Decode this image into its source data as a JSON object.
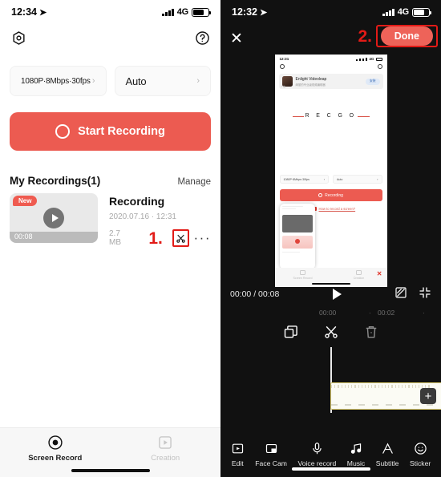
{
  "left": {
    "status": {
      "time": "12:34",
      "network": "4G"
    },
    "header": {
      "settings_icon": "gear-hex-icon",
      "help_icon": "question-circle-icon"
    },
    "selectors": [
      {
        "label": "1080P·8Mbps·30fps",
        "chevron": "›"
      },
      {
        "label": "Auto",
        "chevron": "›"
      }
    ],
    "start_button": {
      "label": "Start Recording"
    },
    "recordings": {
      "title": "My Recordings(1)",
      "manage": "Manage",
      "item": {
        "badge": "New",
        "duration": "00:08",
        "name": "Recording",
        "date": "2020.07.16 · 12:31",
        "size": "2.7 MB",
        "step_marker": "1.",
        "cut_icon": "scissors-icon",
        "more_icon": "ellipsis-icon"
      }
    },
    "tabs": [
      {
        "label": "Screen Record",
        "icon": "record-circle-icon",
        "active": true
      },
      {
        "label": "Creation",
        "icon": "play-square-icon",
        "active": false
      }
    ]
  },
  "right": {
    "status": {
      "time": "12:32",
      "network": "4G"
    },
    "editor": {
      "close_icon": "close-x-icon",
      "step_marker": "2.",
      "done_label": "Done"
    },
    "preview": {
      "inner_status_time": "12:31",
      "inner_network": "4G",
      "ad": {
        "title": "Enlight Videoleap",
        "subtitle": "绚丽的专业级视频编辑器",
        "button": "安装",
        "tag": "广告"
      },
      "watermark": "R E C G O",
      "selectors": [
        "1080P·8Mbps·30fps",
        "Auto"
      ],
      "record_button": "Recording",
      "help_link": "How to record a screen?",
      "tabs": [
        "Screen Record",
        "Creation"
      ]
    },
    "player": {
      "time_display": "00:00 / 00:08",
      "play_icon": "play-icon",
      "ratio_icon": "aspect-ratio-icon",
      "collapse_icon": "collapse-icon"
    },
    "ruler": {
      "ticks": [
        "00:00",
        "00:02"
      ]
    },
    "tools": [
      {
        "name": "duplicate-icon",
        "label": ""
      },
      {
        "name": "split-scissors-icon",
        "label": ""
      },
      {
        "name": "delete-trash-icon",
        "label": ""
      }
    ],
    "timeline": {
      "add_button": "+"
    },
    "bottom_tools": [
      {
        "label": "Edit",
        "icon": "edit-play-icon"
      },
      {
        "label": "Face Cam",
        "icon": "face-cam-icon"
      },
      {
        "label": "Voice record",
        "icon": "microphone-icon"
      },
      {
        "label": "Music",
        "icon": "music-note-icon"
      },
      {
        "label": "Subtitle",
        "icon": "subtitle-a-icon"
      },
      {
        "label": "Sticker",
        "icon": "sticker-smiley-icon"
      }
    ]
  }
}
